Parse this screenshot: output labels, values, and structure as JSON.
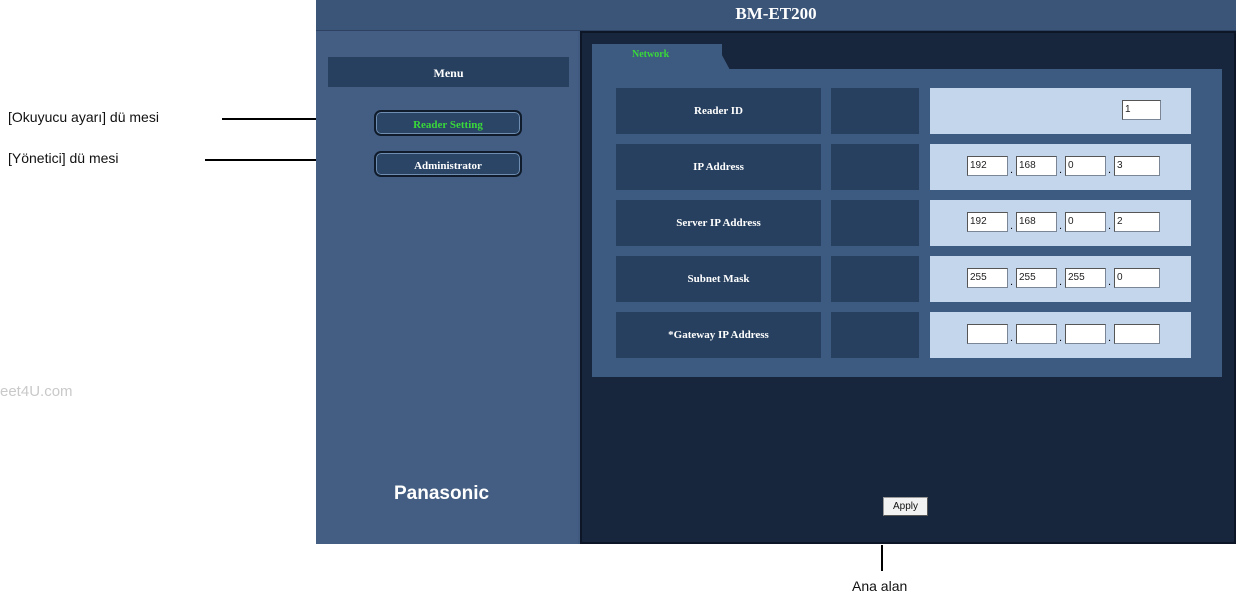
{
  "annotations": {
    "reader_setting": "[Okuyucu ayarı] dü mesi",
    "administrator": "[Yönetici] dü mesi",
    "main_area": "Ana alan",
    "watermark": "eet4U.com"
  },
  "app": {
    "title": "BM-ET200",
    "menu_title": "Menu",
    "nav": {
      "reader_setting": "Reader Setting",
      "administrator": "Administrator"
    },
    "brand": "Panasonic"
  },
  "main": {
    "tab": "Network",
    "rows": {
      "reader_id": {
        "label": "Reader ID",
        "value": "1"
      },
      "ip": {
        "label": "IP Address",
        "octets": [
          "192",
          "168",
          "0",
          "3"
        ]
      },
      "server_ip": {
        "label": "Server IP Address",
        "octets": [
          "192",
          "168",
          "0",
          "2"
        ]
      },
      "subnet": {
        "label": "Subnet Mask",
        "octets": [
          "255",
          "255",
          "255",
          "0"
        ]
      },
      "gateway": {
        "label": "*Gateway IP Address",
        "octets": [
          "",
          "",
          "",
          ""
        ]
      }
    },
    "apply_label": "Apply"
  },
  "colors": {
    "active_nav_text": "#39d93a",
    "panel_bg": "#3d5a80",
    "main_bg": "#17263d",
    "value_bg": "#c4d6ec"
  }
}
